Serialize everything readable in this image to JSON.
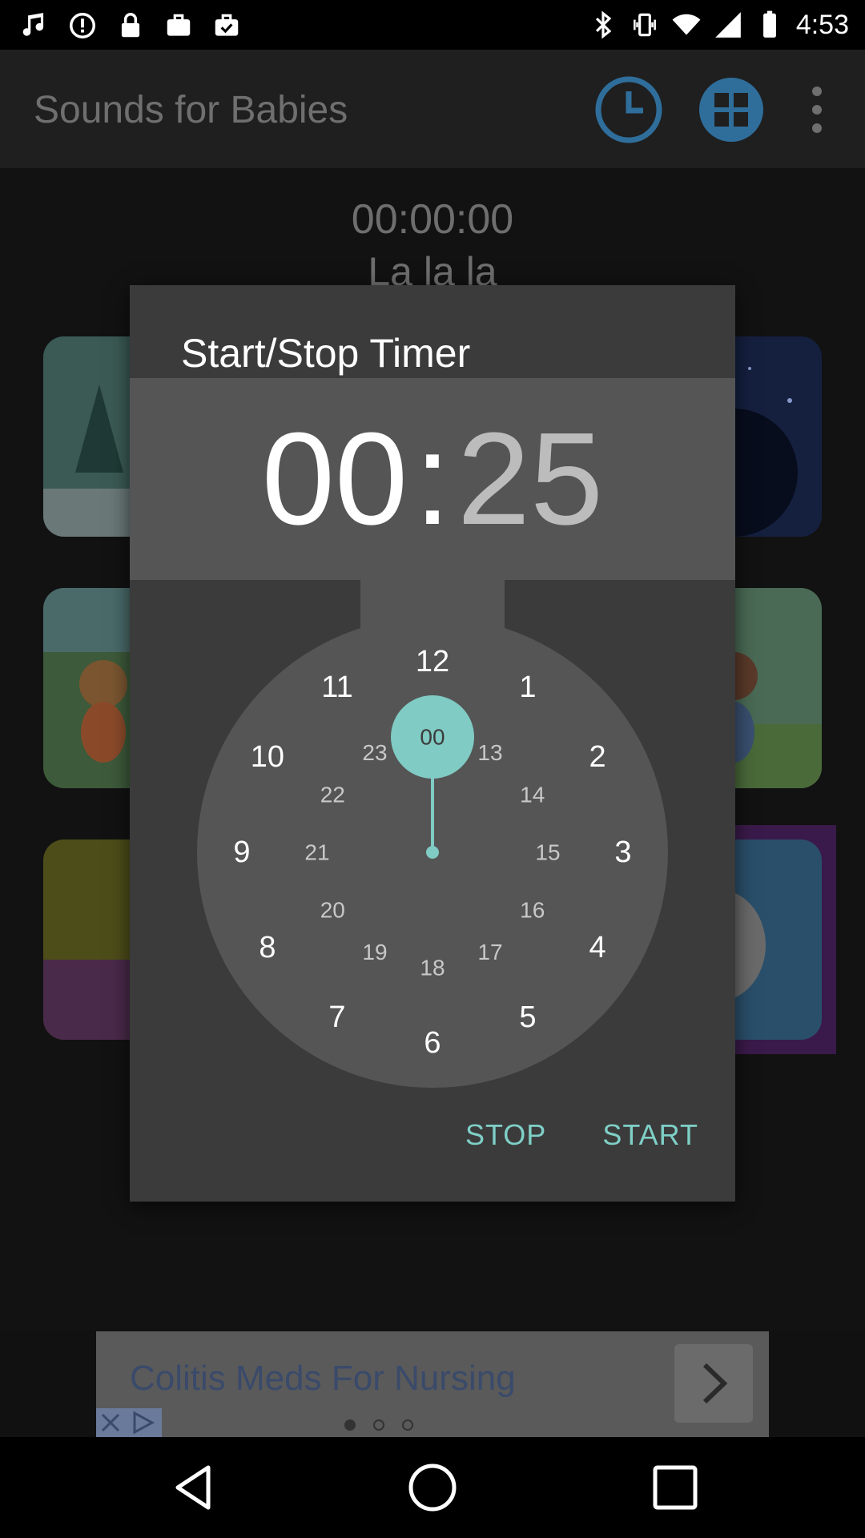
{
  "status_bar": {
    "time": "4:53",
    "left_icons": [
      "music-note-icon",
      "alert-circle-icon",
      "lock-icon",
      "briefcase-icon",
      "briefcase-check-icon"
    ],
    "right_icons": [
      "bluetooth-icon",
      "vibrate-icon",
      "wifi-icon",
      "signal-icon",
      "battery-icon"
    ]
  },
  "app_bar": {
    "title": "Sounds for Babies",
    "actions": [
      "clock-icon",
      "grid-icon",
      "overflow-menu-icon"
    ],
    "accent_color": "#2f6e9b"
  },
  "main": {
    "elapsed_time": "00:00:00",
    "track_name": "La la la"
  },
  "dialog": {
    "title": "Start/Stop Timer",
    "hours": "00",
    "separator": ":",
    "minutes": "25",
    "selected_value": "00",
    "outer_numbers": [
      "12",
      "1",
      "2",
      "3",
      "4",
      "5",
      "6",
      "7",
      "8",
      "9",
      "10",
      "11"
    ],
    "inner_numbers": [
      "00",
      "13",
      "14",
      "15",
      "16",
      "17",
      "18",
      "19",
      "20",
      "21",
      "22",
      "23"
    ],
    "buttons": {
      "stop": "STOP",
      "start": "START"
    },
    "accent_color": "#80cbc4"
  },
  "ad": {
    "text": "Colitis Meds For Nursing",
    "icons": [
      "arrow-right-icon",
      "ad-choices-icon",
      "close-icon"
    ]
  },
  "nav_bar": {
    "icons": [
      "back-icon",
      "home-icon",
      "recents-icon"
    ]
  }
}
